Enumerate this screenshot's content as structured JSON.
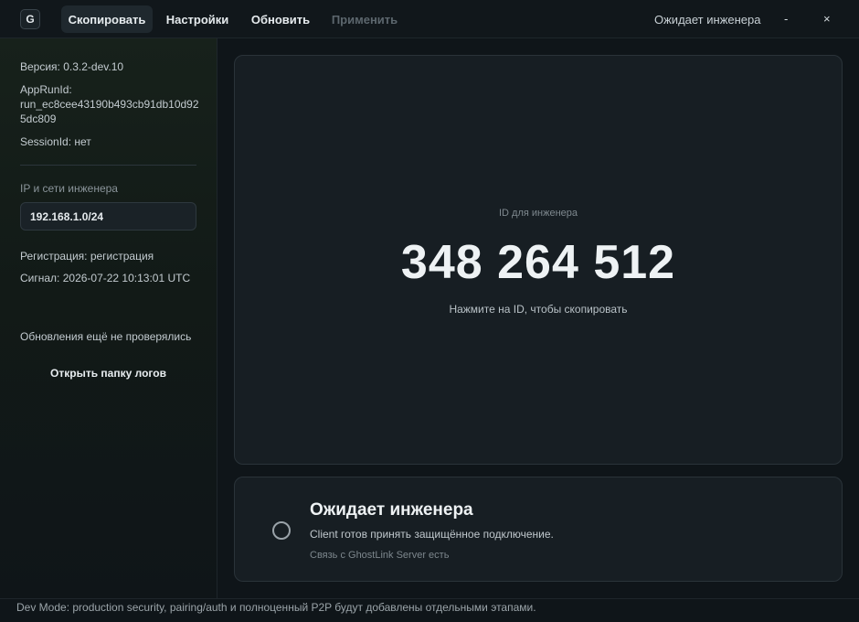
{
  "titlebar": {
    "logo_letter": "G",
    "copy_label": "Скопировать",
    "settings_label": "Настройки",
    "update_label": "Обновить",
    "apply_label": "Применить",
    "status": "Ожидает инженера",
    "minimize": "-",
    "close": "×"
  },
  "sidebar": {
    "version": "Версия: 0.3.2-dev.10",
    "apprun_label": "AppRunId:",
    "apprun_value_1": "run_ec8cee43190b493cb91db10d92",
    "apprun_value_2": "5dc809",
    "session": "SessionId: нет",
    "ip_label": "IP и сети инженера",
    "ip_value": "192.168.1.0/24",
    "registration": "Регистрация: регистрация",
    "signal": "Сигнал: 2026-07-22 10:13:01 UTC",
    "updates": "Обновления ещё не проверялись",
    "open_logs": "Открыть папку логов"
  },
  "id_card": {
    "label": "ID для инженера",
    "value": "348 264 512",
    "hint": "Нажмите на ID, чтобы скопировать"
  },
  "status_card": {
    "title": "Ожидает инженера",
    "description": "Client готов принять защищённое подключение.",
    "server": "Связь с GhostLink Server есть"
  },
  "footer": {
    "text": "Dev Mode: production security, pairing/auth и полноценный P2P будут добавлены отдельными этапами."
  },
  "colors": {
    "background": "#0f1519",
    "card": "#171e23",
    "accent_text": "#eef2f4"
  }
}
